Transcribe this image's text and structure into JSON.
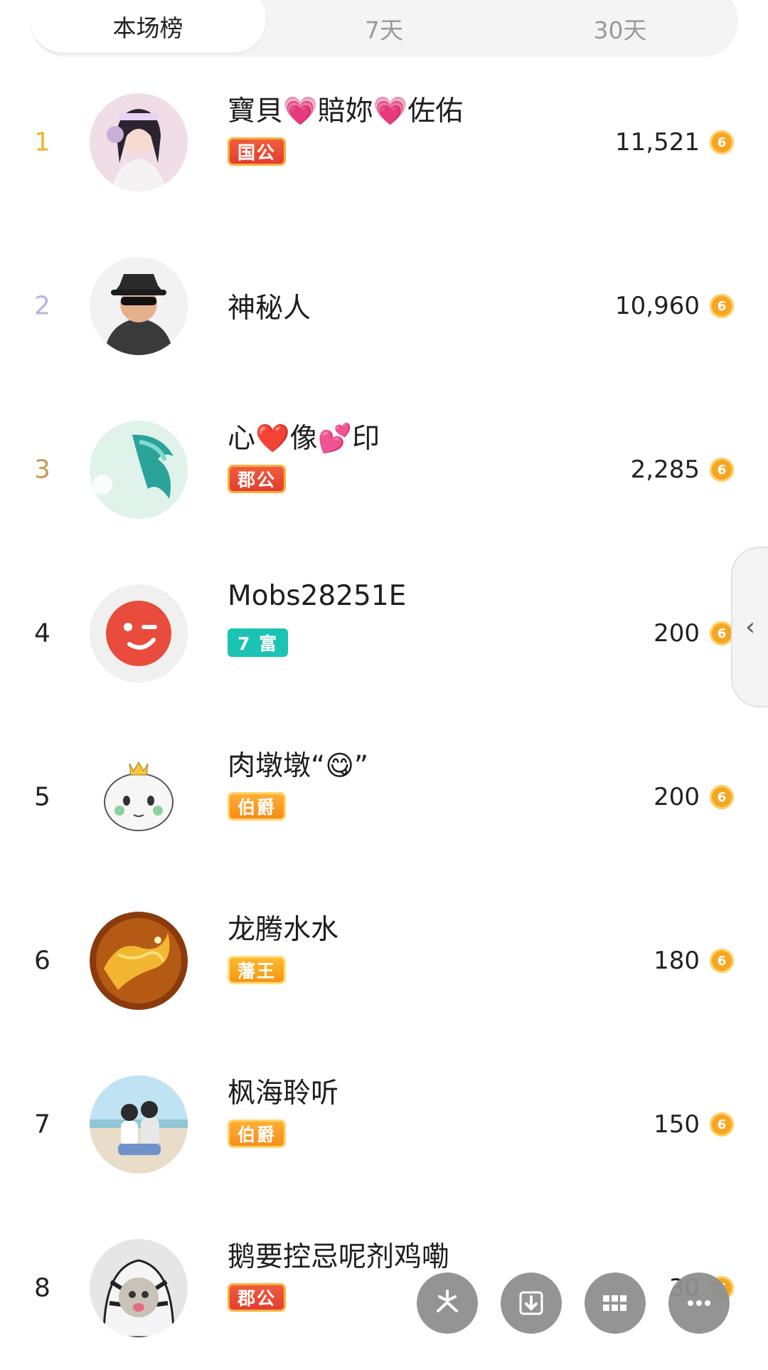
{
  "tabs": [
    {
      "label": "本场榜",
      "active": true
    },
    {
      "label": "7天",
      "active": false
    },
    {
      "label": "30天",
      "active": false
    }
  ],
  "colors": {
    "rank1": "#f0b428",
    "rank2": "#b6b3e8",
    "rank3": "#c79a55",
    "coin": "#f5a623"
  },
  "rows": [
    {
      "rank": "1",
      "name": "寶貝💗賠妳💗佐佑",
      "badge": "国公",
      "score": "11,521"
    },
    {
      "rank": "2",
      "name": "神秘人",
      "badge": "",
      "score": "10,960"
    },
    {
      "rank": "3",
      "name": "心❤️像💕印",
      "badge": "郡公",
      "score": "2,285"
    },
    {
      "rank": "4",
      "name": "Mobs28251E",
      "badge": "7 富",
      "score": "200"
    },
    {
      "rank": "5",
      "name": "肉墩墩“😋”",
      "badge": "伯爵",
      "score": "200"
    },
    {
      "rank": "6",
      "name": "龙腾水水",
      "badge": "藩王",
      "score": "180"
    },
    {
      "rank": "7",
      "name": "枫海聆听",
      "badge": "伯爵",
      "score": "150"
    },
    {
      "rank": "8",
      "name": "鹅要控忌呢剂鸡嘞",
      "badge": "郡公",
      "score": "30"
    }
  ],
  "coin_glyph": "6",
  "side_handle_glyph": "‹",
  "fab_icons": [
    "share-icon",
    "download-icon",
    "grid-icon",
    "more-icon"
  ]
}
